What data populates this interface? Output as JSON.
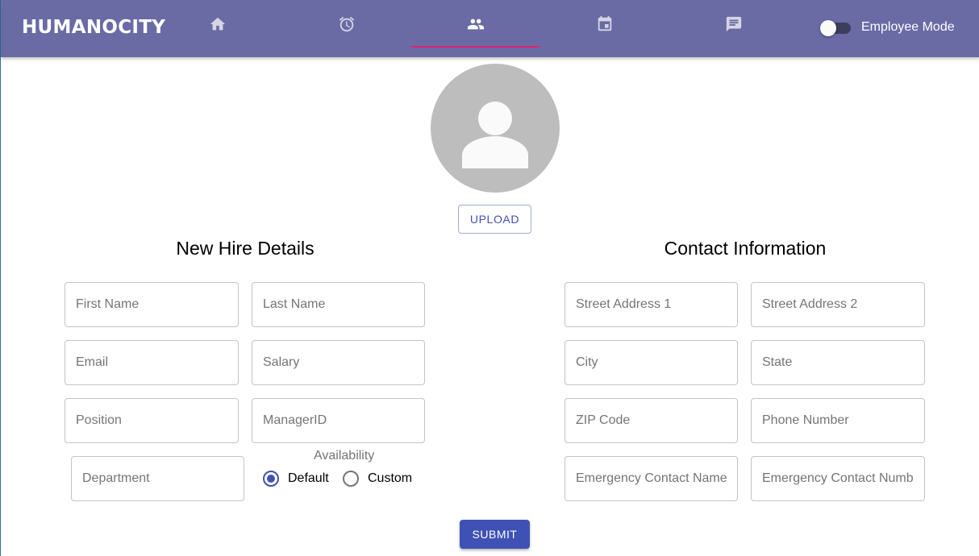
{
  "appbar": {
    "brand": "HUMANOCITY",
    "tabs": [
      {
        "icon": "home-icon",
        "active": false
      },
      {
        "icon": "alarm-icon",
        "active": false
      },
      {
        "icon": "people-icon",
        "active": true
      },
      {
        "icon": "calendar-icon",
        "active": false
      },
      {
        "icon": "message-icon",
        "active": false
      }
    ],
    "mode_toggle_label": "Employee Mode",
    "mode_toggle_on": false
  },
  "colors": {
    "appbar": "#6a6ba5",
    "tab_indicator": "#e0226e",
    "primary": "#3f51b5",
    "avatar_bg": "#bdbdbd"
  },
  "avatar": {
    "icon": "person-icon"
  },
  "upload_label": "UPLOAD",
  "new_hire": {
    "title": "New Hire Details",
    "fields": {
      "first_name": "First Name",
      "last_name": "Last Name",
      "email": "Email",
      "salary": "Salary",
      "position": "Position",
      "manager_id": "ManagerID",
      "department": "Department"
    },
    "availability": {
      "label": "Availability",
      "options": [
        "Default",
        "Custom"
      ],
      "selected": "Default"
    }
  },
  "contact": {
    "title": "Contact Information",
    "fields": {
      "street1": "Street Address 1",
      "street2": "Street Address 2",
      "city": "City",
      "state": "State",
      "zip": "ZIP Code",
      "phone": "Phone Number",
      "emergency_name": "Emergency Contact Name",
      "emergency_number": "Emergency Contact Number"
    }
  },
  "submit_label": "SUBMIT"
}
